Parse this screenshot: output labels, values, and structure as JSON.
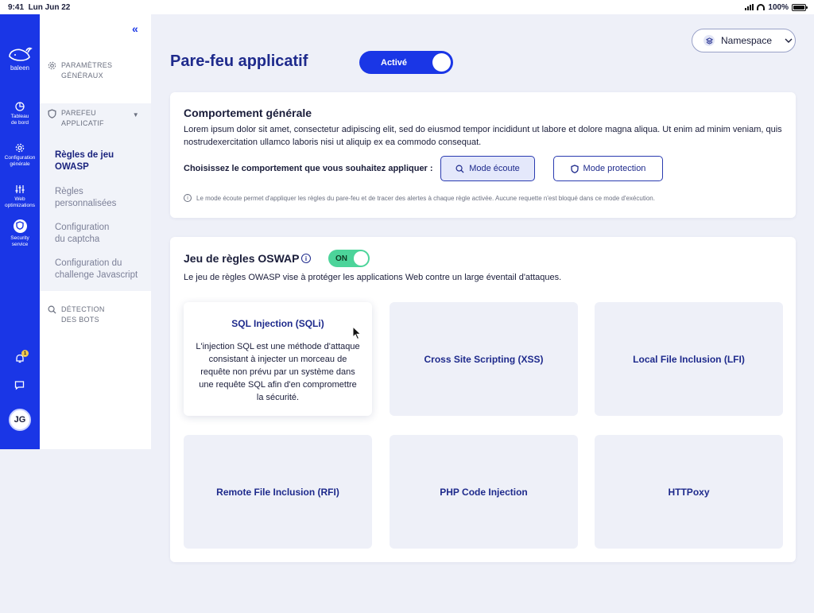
{
  "status_bar": {
    "time": "9:41",
    "date": "Lun Jun 22",
    "battery": "100%"
  },
  "rail": {
    "brand": "baleen",
    "items": [
      {
        "icon": "pie-chart-icon",
        "label1": "Tableau",
        "label2": "de bord"
      },
      {
        "icon": "gear-icon",
        "label1": "Configuration",
        "label2": "générale"
      },
      {
        "icon": "sliders-icon",
        "label1": "Web",
        "label2": "optimizations"
      },
      {
        "icon": "shield-icon",
        "label1": "Security",
        "label2": "service"
      }
    ],
    "notification_count": "1",
    "avatar": "JG"
  },
  "subnav": {
    "collapse_icon": "«",
    "params": {
      "line1": "PARAMÈTRES",
      "line2": "GÉNÉRAUX"
    },
    "firewall": {
      "line1": "PAREFEU",
      "line2": "APPLICATIF"
    },
    "items": [
      {
        "line1": "Règles de jeu",
        "line2": "OWASP"
      },
      {
        "line1": "Règles",
        "line2": "personnalisées"
      },
      {
        "line1": "Configuration",
        "line2": "du captcha"
      },
      {
        "line1": "Configuration du",
        "line2": "challenge Javascript"
      }
    ],
    "bots": {
      "line1": "DÉTECTION",
      "line2": "DES BOTS"
    }
  },
  "header": {
    "title": "Pare-feu applicatif",
    "toggle_label": "Activé",
    "namespace_label": "Namespace"
  },
  "behavior": {
    "title": "Comportement générale",
    "text": "Lorem ipsum dolor sit amet, consectetur adipiscing elit, sed do eiusmod tempor incididunt ut labore et dolore magna aliqua. Ut enim ad minim veniam, quis nostrudexercitation ullamco laboris nisi ut aliquip ex ea commodo consequat.",
    "choose_label": "Choisissez le comportement que vous souhaitez appliquer :",
    "mode_listen": "Mode écoute",
    "mode_protect": "Mode protection",
    "note": "Le mode écoute permet d'appliquer les règles du pare-feu et de tracer des alertes à chaque règle activée. Aucune requette n'est bloqué dans ce mode d'exécution."
  },
  "oswap": {
    "title": "Jeu de règles OSWAP",
    "toggle_label": "ON",
    "description": "Le jeu de règles OWASP vise à protéger les applications Web contre un large éventail d'attaques.",
    "rules": [
      {
        "title": "SQL Injection (SQLi)",
        "description": "L'injection SQL est une méthode d'attaque consistant à injecter un morceau de requête non prévu par un système dans une requête SQL afin d'en compromettre la sécurité."
      },
      {
        "title": "Cross Site Scripting (XSS)"
      },
      {
        "title": "Local File Inclusion (LFI)"
      },
      {
        "title": "Remote File Inclusion (RFI)"
      },
      {
        "title": "PHP Code Injection"
      },
      {
        "title": "HTTPoxy"
      }
    ]
  },
  "colors": {
    "brand_blue": "#1a36e6",
    "navy": "#1e2a8c",
    "on_green": "#4cd49a",
    "badge_yellow": "#f2c94c"
  }
}
